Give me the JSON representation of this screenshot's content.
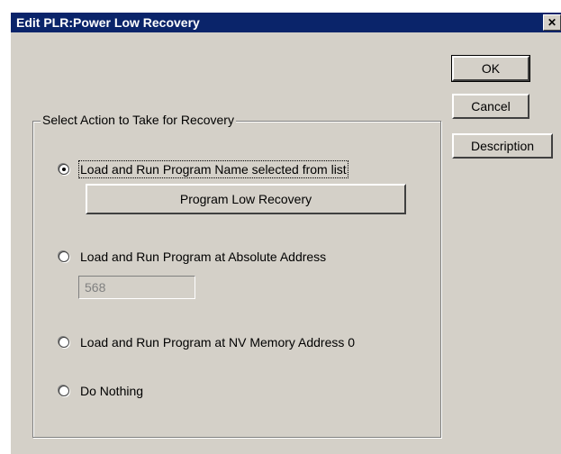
{
  "window": {
    "title": "Edit PLR:Power Low Recovery",
    "close_glyph": "✕"
  },
  "buttons": {
    "ok": "OK",
    "cancel": "Cancel",
    "description": "Description"
  },
  "group": {
    "title": "Select Action to Take for Recovery",
    "options": [
      {
        "label": "Load and Run Program Name selected from list",
        "checked": true
      },
      {
        "label": "Load and Run Program at Absolute Address",
        "checked": false
      },
      {
        "label": "Load and Run Program at NV Memory Address 0",
        "checked": false
      },
      {
        "label": "Do Nothing",
        "checked": false
      }
    ],
    "program_button": "Program Low Recovery",
    "address_value": "568"
  },
  "colors": {
    "titlebar": "#0a246a",
    "face": "#d4d0c8"
  }
}
